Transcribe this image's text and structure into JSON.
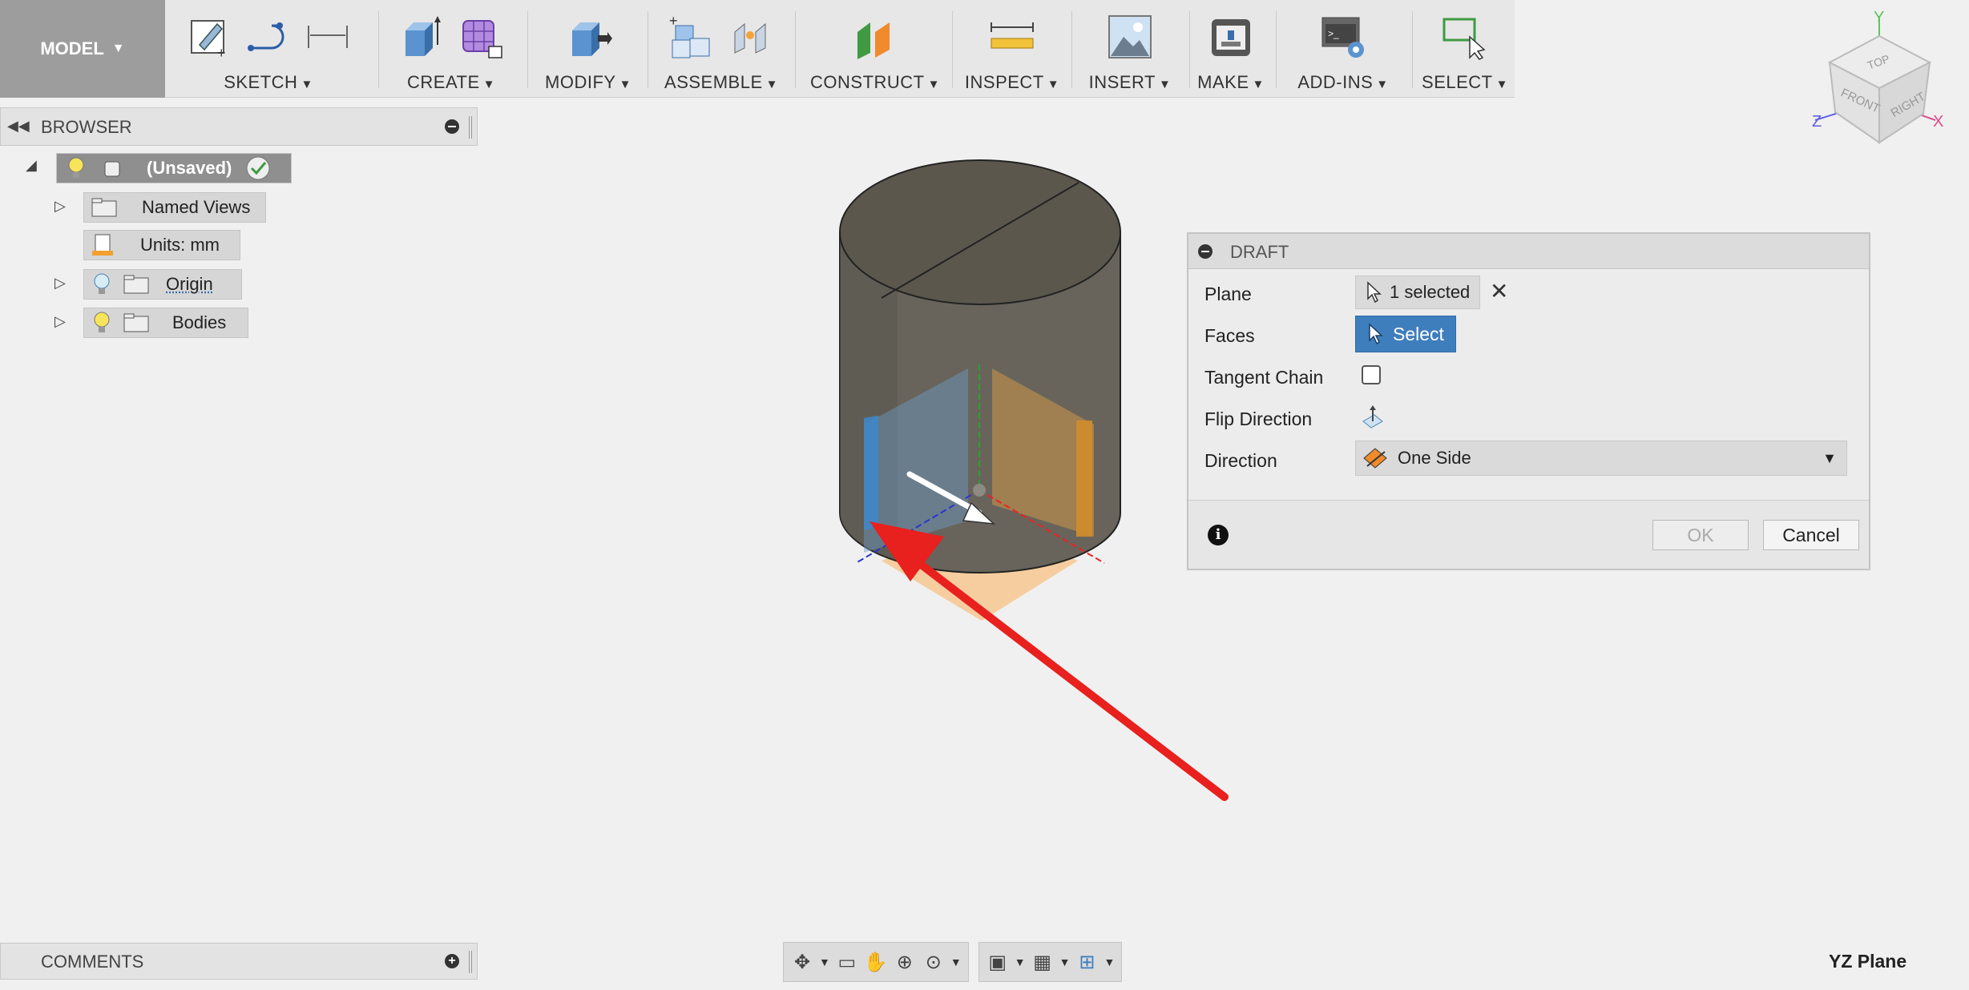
{
  "toolbar": {
    "model_label": "MODEL",
    "groups": [
      {
        "label": "SKETCH"
      },
      {
        "label": "CREATE"
      },
      {
        "label": "MODIFY"
      },
      {
        "label": "ASSEMBLE"
      },
      {
        "label": "CONSTRUCT"
      },
      {
        "label": "INSPECT"
      },
      {
        "label": "INSERT"
      },
      {
        "label": "MAKE"
      },
      {
        "label": "ADD-INS"
      },
      {
        "label": "SELECT"
      }
    ]
  },
  "browser": {
    "title": "BROWSER",
    "root": "(Unsaved)",
    "items": [
      {
        "label": "Named Views"
      },
      {
        "label": "Units: mm"
      },
      {
        "label": "Origin"
      },
      {
        "label": "Bodies"
      }
    ]
  },
  "draft": {
    "title": "DRAFT",
    "rows": {
      "plane_label": "Plane",
      "plane_value": "1 selected",
      "faces_label": "Faces",
      "faces_value": "Select",
      "tangent_label": "Tangent Chain",
      "flip_label": "Flip Direction",
      "direction_label": "Direction",
      "direction_value": "One Side"
    },
    "ok_label": "OK",
    "cancel_label": "Cancel"
  },
  "viewcube": {
    "top": "TOP",
    "front": "FRONT",
    "right": "RIGHT",
    "axis_x": "X",
    "axis_y": "Y",
    "axis_z": "Z"
  },
  "comments": {
    "title": "COMMENTS"
  },
  "status": {
    "text": "YZ Plane"
  },
  "colors": {
    "accent": "#3f7ebd",
    "annotation_arrow": "#e8201e",
    "body": "#6b6559"
  }
}
